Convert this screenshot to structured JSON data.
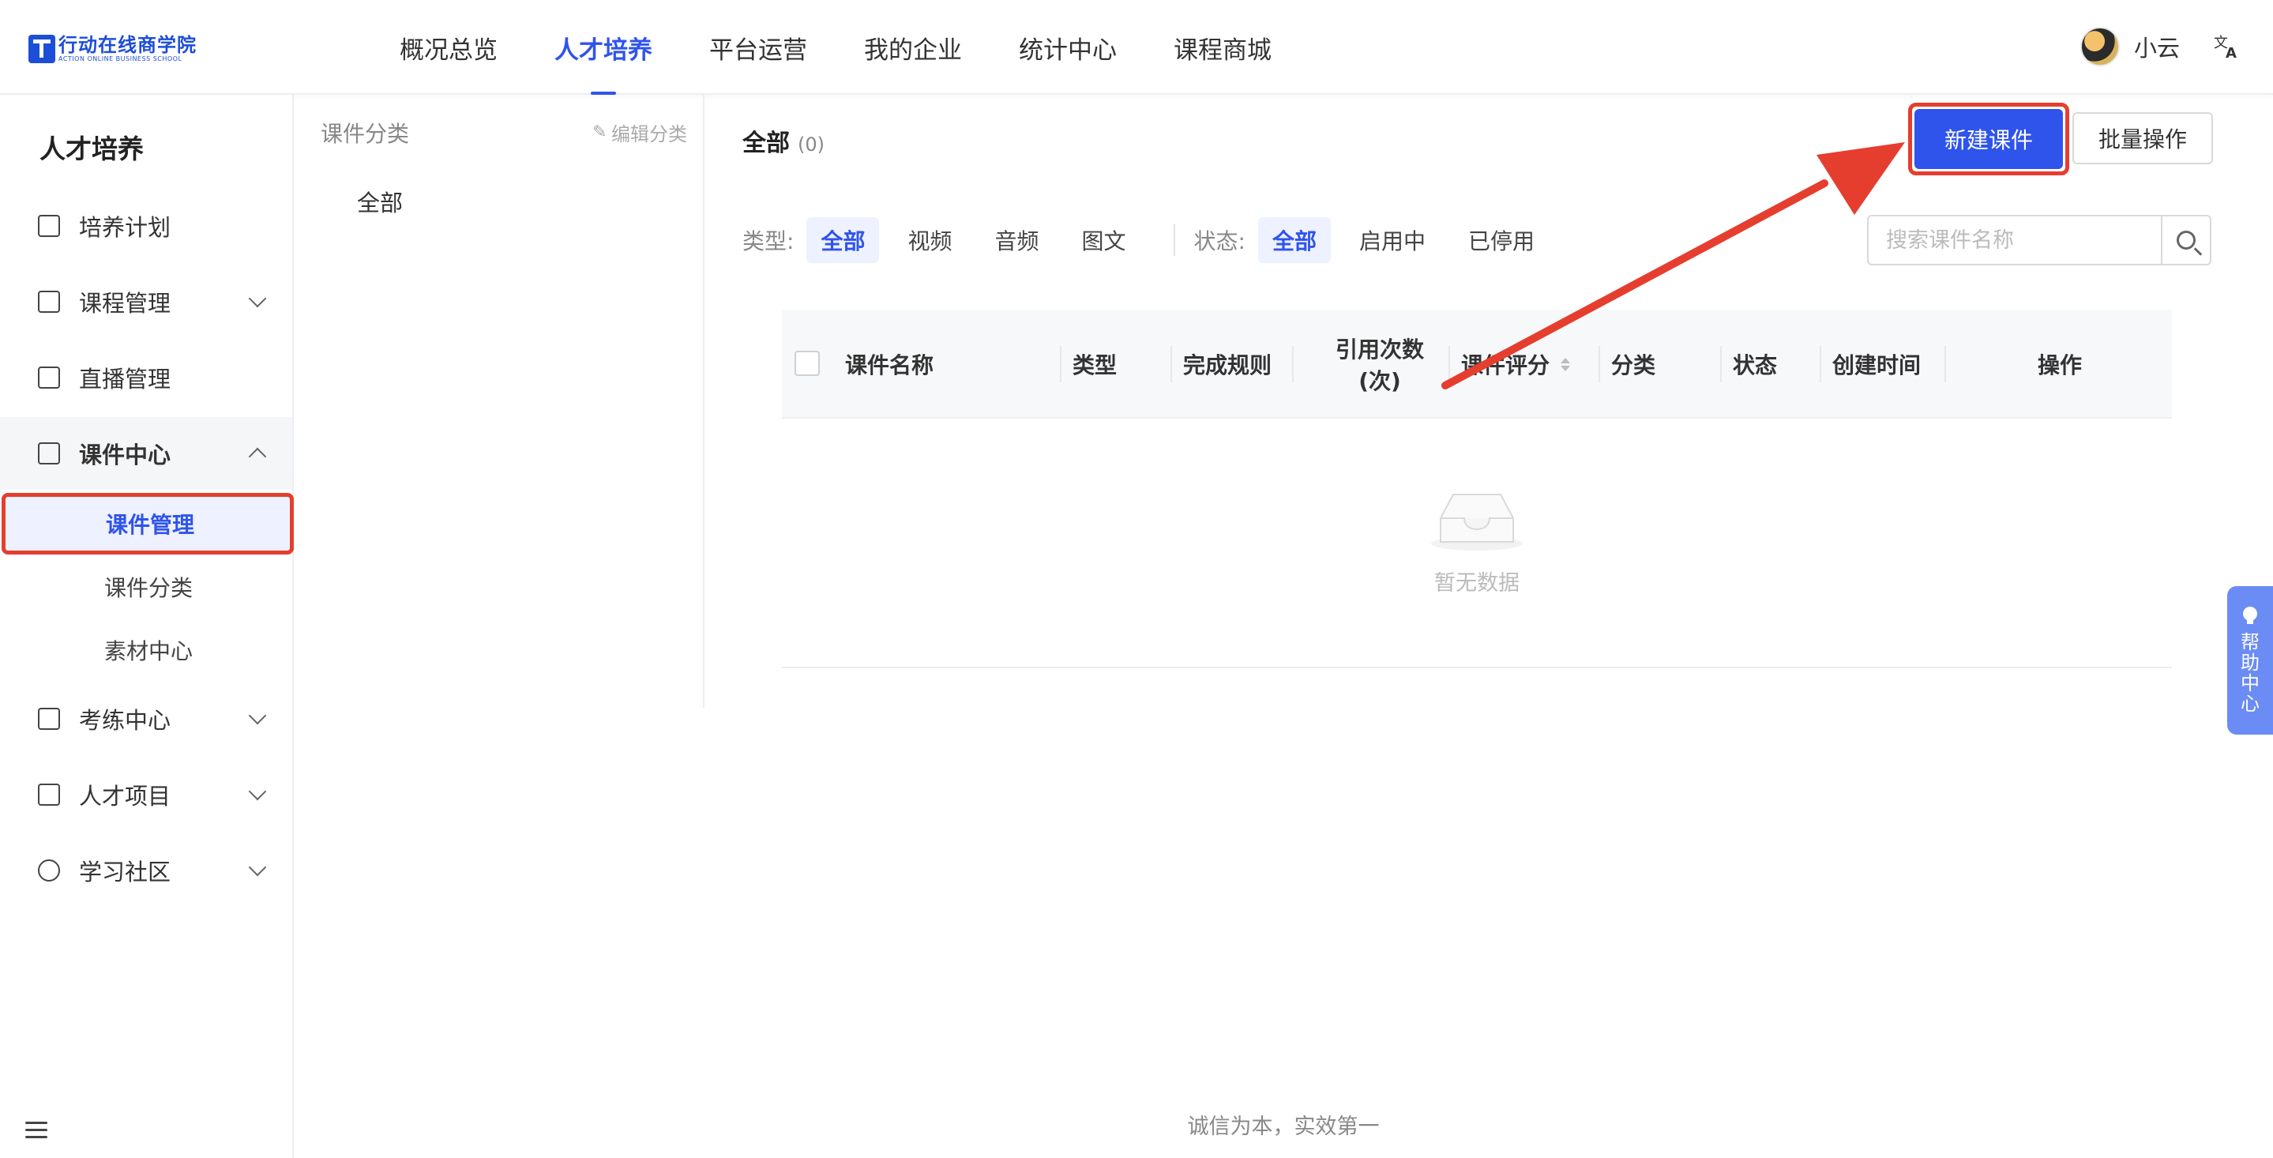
{
  "header": {
    "logo_cn": "行动在线商学院",
    "logo_en": "ACTION ONLINE BUSINESS SCHOOL",
    "nav": [
      {
        "label": "概况总览"
      },
      {
        "label": "人才培养"
      },
      {
        "label": "平台运营"
      },
      {
        "label": "我的企业"
      },
      {
        "label": "统计中心"
      },
      {
        "label": "课程商城"
      }
    ],
    "active_nav": "人才培养",
    "user_name": "小云",
    "lang_glyph": "文A"
  },
  "sidebar": {
    "title": "人才培养",
    "items": [
      {
        "label": "培养计划",
        "icon": "calendar-icon"
      },
      {
        "label": "课程管理",
        "icon": "book-icon",
        "expandable": true
      },
      {
        "label": "直播管理",
        "icon": "video-camera-icon"
      },
      {
        "label": "课件中心",
        "icon": "inbox-icon",
        "expanded": true
      },
      {
        "label": "考练中心",
        "icon": "exam-icon",
        "expandable": true
      },
      {
        "label": "人才项目",
        "icon": "project-icon",
        "expandable": true
      },
      {
        "label": "学习社区",
        "icon": "chat-icon",
        "expandable": true
      }
    ],
    "sub_items": [
      {
        "label": "课件管理",
        "active": true
      },
      {
        "label": "课件分类"
      },
      {
        "label": "素材中心"
      }
    ]
  },
  "category_panel": {
    "title": "课件分类",
    "edit_label": "编辑分类",
    "items": [
      "全部"
    ]
  },
  "main": {
    "title": "全部",
    "count": "(0)",
    "new_button": "新建课件",
    "batch_button": "批量操作",
    "type_filter": {
      "label": "类型:",
      "options": [
        "全部",
        "视频",
        "音频",
        "图文"
      ],
      "selected": "全部"
    },
    "status_filter": {
      "label": "状态:",
      "options": [
        "全部",
        "启用中",
        "已停用"
      ],
      "selected": "全部"
    },
    "search": {
      "placeholder": "搜索课件名称",
      "value": ""
    },
    "table": {
      "columns": [
        "课件名称",
        "类型",
        "完成规则",
        "引用次数\n(次)",
        "课件评分",
        "分类",
        "状态",
        "创建时间",
        "操作"
      ],
      "rows": [],
      "empty_text": "暂无数据"
    }
  },
  "footer": {
    "text": "诚信为本，实效第一"
  },
  "help": {
    "label": "帮助中心"
  },
  "colors": {
    "accent": "#2f54eb",
    "annotation": "#e53e2f",
    "help_tab": "#6b8cf5"
  }
}
